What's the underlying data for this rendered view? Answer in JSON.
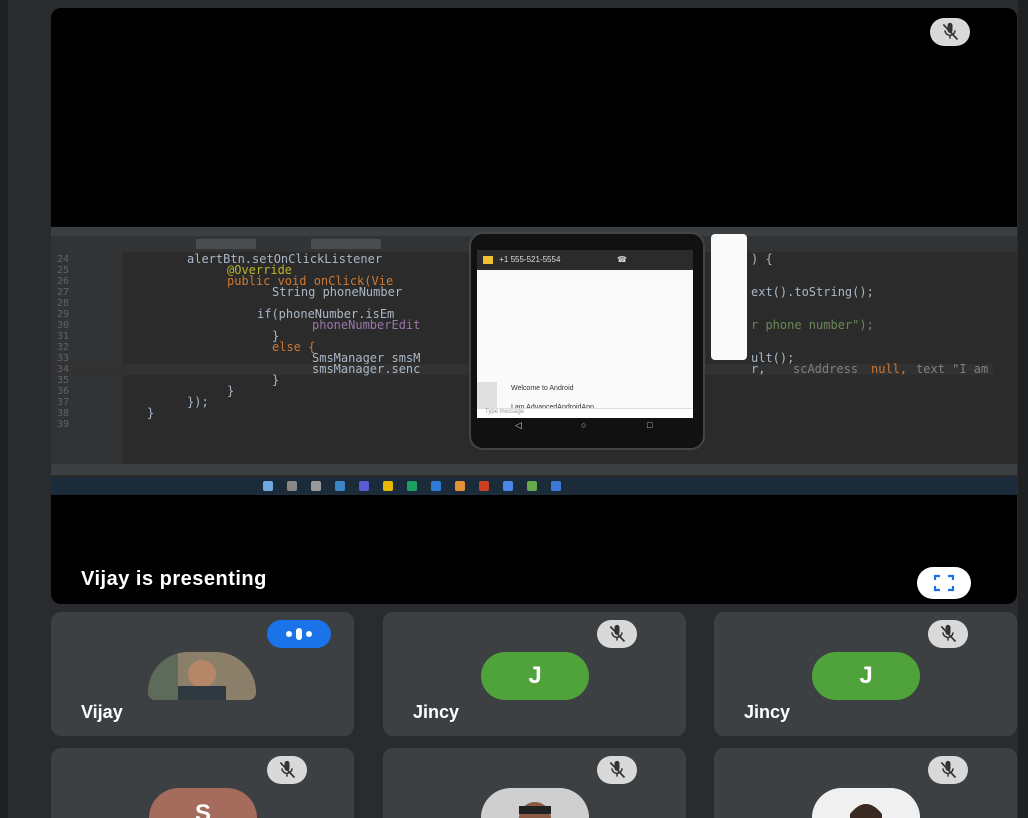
{
  "presenter": {
    "label": "Vijay is presenting",
    "fullscreen_icon": "fullscreen-icon",
    "mic_icon": "mic-off-icon"
  },
  "shared_screen": {
    "code_lines": [
      {
        "num": "24",
        "text": "alertBtn.setOnClickListener"
      },
      {
        "num": "25",
        "text": "@Override"
      },
      {
        "num": "26",
        "text": "public void onClick(Vie"
      },
      {
        "num": "27",
        "text": "String phoneNumber"
      },
      {
        "num": "28",
        "text": ""
      },
      {
        "num": "29",
        "text": "if(phoneNumber.isEm"
      },
      {
        "num": "30",
        "text": "phoneNumberEdit"
      },
      {
        "num": "31",
        "text": "}"
      },
      {
        "num": "32",
        "text": "else {"
      },
      {
        "num": "33",
        "text": "SmsManager smsM"
      },
      {
        "num": "34",
        "text": "smsManager.senc"
      },
      {
        "num": "35",
        "text": "}"
      },
      {
        "num": "36",
        "text": "}"
      },
      {
        "num": "37",
        "text": "});"
      },
      {
        "num": "38",
        "text": "}"
      },
      {
        "num": "39",
        "text": ""
      }
    ],
    "right_fragments": {
      "line24": ") {",
      "line27": "ext().toString();",
      "line30": "r phone number\");",
      "line33": "ult();",
      "line34_a": "r,",
      "line34_b": "scAddress",
      "line34_c": "null,",
      "line34_d": "text \"I am"
    },
    "phone": {
      "contact": "+1 555-521-5554",
      "messages": [
        "Welcome to Android",
        "I am AdvancedAndroidApp"
      ],
      "input_placeholder": "Type message"
    }
  },
  "participants": [
    {
      "name": "Vijay",
      "avatar_type": "photo",
      "status": "speaking"
    },
    {
      "name": "Jincy",
      "avatar_type": "letter",
      "letter": "J",
      "avatar_color": "#4fa33a",
      "status": "muted"
    },
    {
      "name": "Jincy",
      "avatar_type": "letter",
      "letter": "J",
      "avatar_color": "#4fa33a",
      "status": "muted"
    },
    {
      "name": "",
      "avatar_type": "letter",
      "letter": "S",
      "avatar_color": "#a56b5c",
      "status": "muted"
    },
    {
      "name": "",
      "avatar_type": "photo",
      "status": "muted"
    },
    {
      "name": "",
      "avatar_type": "photo",
      "status": "muted"
    }
  ],
  "colors": {
    "speaking_badge": "#1a73e8",
    "tile_bg": "#3c4043",
    "letter_avatar_green": "#4fa33a",
    "letter_avatar_brown": "#a56b5c"
  }
}
